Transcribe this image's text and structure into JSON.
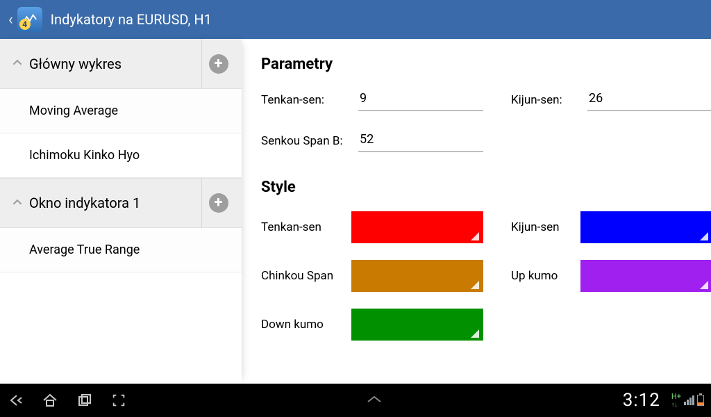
{
  "header": {
    "title": "Indykatory na EURUSD, H1"
  },
  "sidebar": {
    "sections": [
      {
        "label": "Główny wykres",
        "items": [
          {
            "label": "Moving Average",
            "selected": false
          },
          {
            "label": "Ichimoku Kinko Hyo",
            "selected": true
          }
        ]
      },
      {
        "label": "Okno indykatora 1",
        "items": [
          {
            "label": "Average True Range",
            "selected": false
          }
        ]
      }
    ]
  },
  "detail": {
    "params_heading": "Parametry",
    "style_heading": "Style",
    "params": {
      "tenkan": {
        "label": "Tenkan-sen:",
        "value": "9"
      },
      "kijun": {
        "label": "Kijun-sen:",
        "value": "26"
      },
      "senkou": {
        "label": "Senkou Span B:",
        "value": "52"
      }
    },
    "styles": {
      "tenkan": {
        "label": "Tenkan-sen",
        "color": "#ff0000"
      },
      "kijun": {
        "label": "Kijun-sen",
        "color": "#0000ff"
      },
      "chinkou": {
        "label": "Chinkou Span",
        "color": "#c87b00"
      },
      "upkumo": {
        "label": "Up kumo",
        "color": "#a020f0"
      },
      "downkumo": {
        "label": "Down kumo",
        "color": "#009000"
      }
    }
  },
  "navbar": {
    "clock": "3:12",
    "net": "H+"
  }
}
